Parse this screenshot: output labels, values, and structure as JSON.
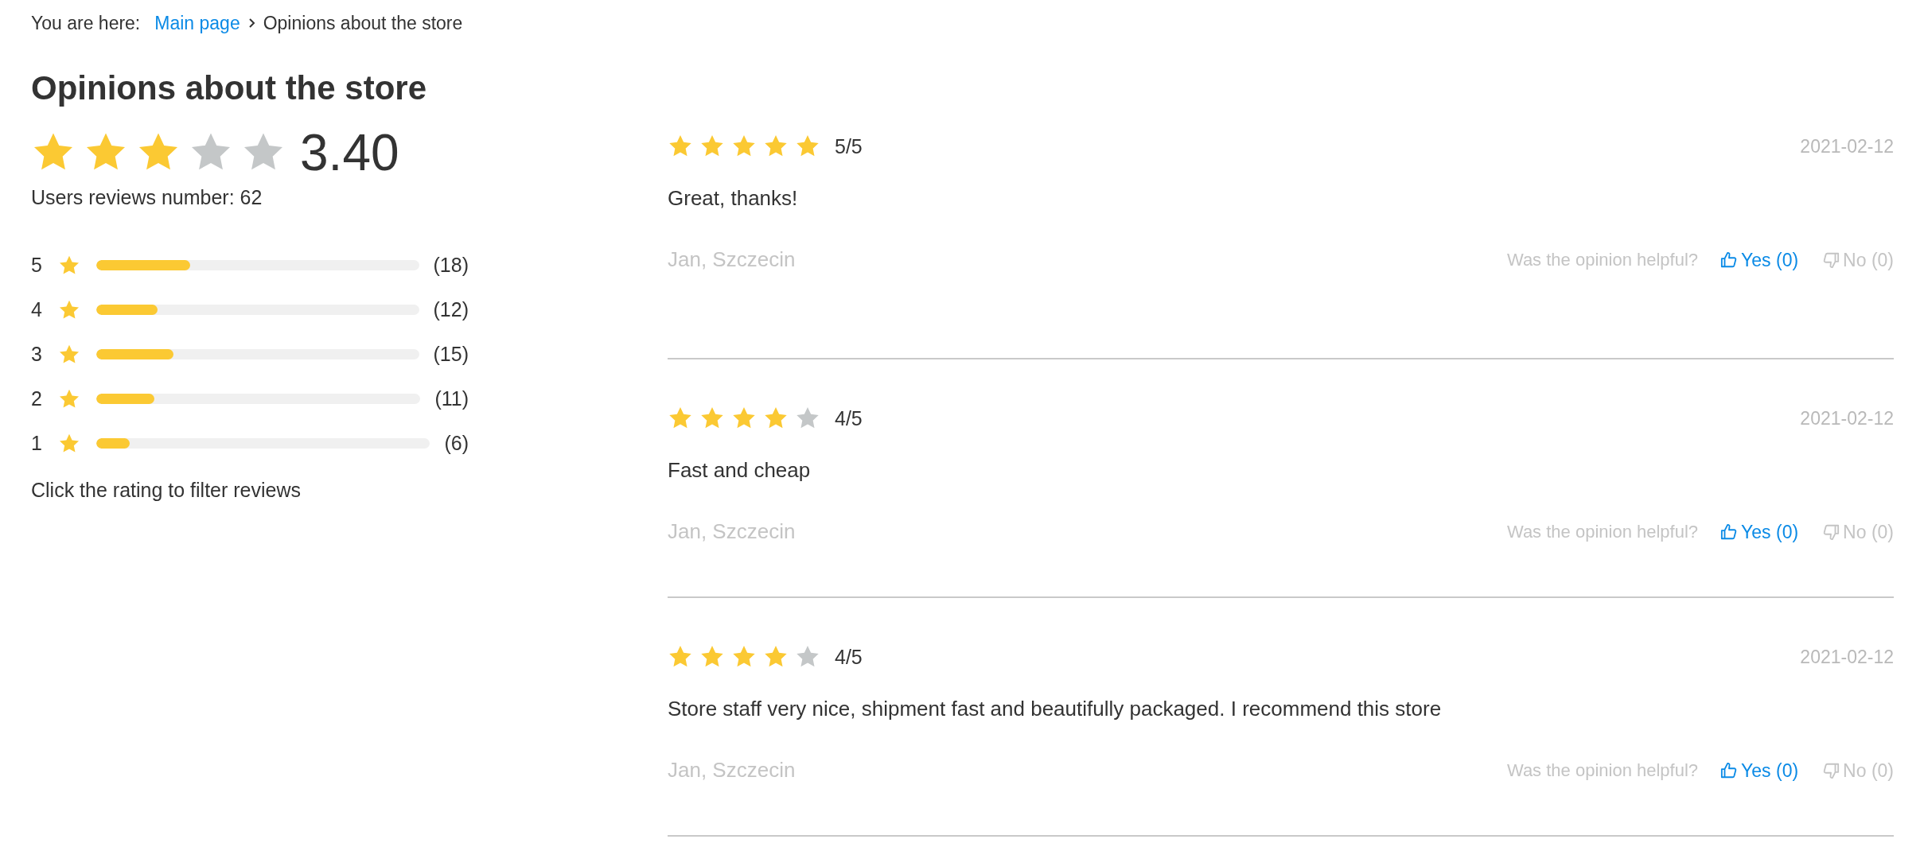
{
  "breadcrumb": {
    "label": "You are here:",
    "links": [
      {
        "text": "Main page",
        "kind": "link"
      },
      {
        "text": "Opinions about the store",
        "kind": "current"
      }
    ]
  },
  "title": "Opinions about the store",
  "summary": {
    "stars": 3,
    "score": "3.40",
    "reviews_number": "Users reviews number: 62"
  },
  "distribution": [
    {
      "rating": "5",
      "level": 0.29,
      "count": "(18)"
    },
    {
      "rating": "4",
      "level": 0.19,
      "count": "(12)"
    },
    {
      "rating": "3",
      "level": 0.24,
      "count": "(15)"
    },
    {
      "rating": "2",
      "level": 0.18,
      "count": "(11)"
    },
    {
      "rating": "1",
      "level": 0.1,
      "count": "(6)"
    }
  ],
  "filter_hint": "Click the rating to filter reviews",
  "reviews": [
    {
      "stars": 5,
      "rating": "5/5",
      "date": "2021-02-12",
      "text": "Great, thanks!",
      "author": "Jan, Szczecin",
      "helpful_label": "Was the opinion helpful?",
      "yes": "Yes (0)",
      "no": "No (0)"
    },
    {
      "stars": 4,
      "rating": "4/5",
      "date": "2021-02-12",
      "text": "Fast and cheap",
      "author": "Jan, Szczecin",
      "helpful_label": "Was the opinion helpful?",
      "yes": "Yes (0)",
      "no": "No (0)"
    },
    {
      "stars": 4,
      "rating": "4/5",
      "date": "2021-02-12",
      "text": "Store staff very nice, shipment fast and beautifully packaged. I recommend this store",
      "author": "Jan, Szczecin",
      "helpful_label": "Was the opinion helpful?",
      "yes": "Yes (0)",
      "no": "No (0)"
    }
  ]
}
